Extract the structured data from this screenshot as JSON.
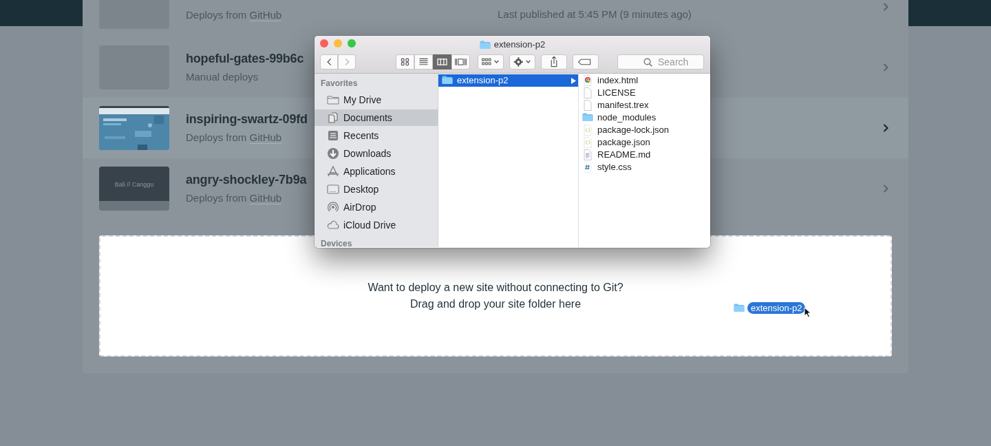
{
  "sites": [
    {
      "source": "Deploys from ",
      "source_link": "GitHub",
      "published": "Last published at 5:45 PM (9 minutes ago)",
      "thumbnail": {
        "kind": "blank"
      },
      "highlighted": false
    },
    {
      "name": "hopeful-gates-99b6c",
      "source": "Manual deploys",
      "thumbnail": {
        "kind": "blank"
      },
      "highlighted": false
    },
    {
      "name": "inspiring-swartz-09fd",
      "source": "Deploys from ",
      "source_link": "GitHub",
      "highlighted": true
    },
    {
      "name": "angry-shockley-7b9a",
      "source": "Deploys from ",
      "source_link": "GitHub",
      "thumbnail": {
        "kind": "caption",
        "caption": "Bali // Canggu"
      },
      "highlighted": false
    }
  ],
  "dropzone": {
    "lines": [
      "Want to deploy a new site without connecting to Git?",
      "Drag and drop your site folder here"
    ],
    "drag_item": {
      "label": "extension-p2"
    }
  },
  "finder": {
    "title": "extension-p2",
    "back": {
      "disabled": false
    },
    "forward": {
      "disabled": true
    },
    "view_modes": [
      {
        "kind": "icons",
        "selected": false
      },
      {
        "kind": "list",
        "selected": false
      },
      {
        "kind": "columns",
        "selected": true
      },
      {
        "kind": "gallery",
        "selected": false
      }
    ],
    "search": {
      "placeholder": "Search"
    },
    "sidebar": [
      {
        "heading": "Favorites",
        "items": [
          {
            "label": "My Drive",
            "kind": "drive",
            "selected": false
          },
          {
            "label": "Documents",
            "kind": "documents",
            "selected": true
          },
          {
            "label": "Recents",
            "kind": "recents",
            "selected": false
          },
          {
            "label": "Downloads",
            "kind": "downloads",
            "selected": false
          },
          {
            "label": "Applications",
            "kind": "applications",
            "selected": false
          },
          {
            "label": "Desktop",
            "kind": "desktop",
            "selected": false
          },
          {
            "label": "AirDrop",
            "kind": "airdrop",
            "selected": false
          },
          {
            "label": "iCloud Drive",
            "kind": "icloud",
            "selected": false
          }
        ]
      },
      {
        "heading": "Devices"
      }
    ],
    "columns": [
      [
        {
          "name": "extension-p2",
          "kind": "folder",
          "selected": true
        }
      ],
      [
        {
          "name": "index.html",
          "kind": "html",
          "selected": false
        },
        {
          "name": "LICENSE",
          "kind": "file",
          "selected": false
        },
        {
          "name": "manifest.trex",
          "kind": "file",
          "selected": false
        },
        {
          "name": "node_modules",
          "kind": "folder",
          "selected": false
        },
        {
          "name": "package-lock.json",
          "kind": "json",
          "selected": false
        },
        {
          "name": "package.json",
          "kind": "json",
          "selected": false
        },
        {
          "name": "README.md",
          "kind": "text",
          "selected": false
        },
        {
          "name": "style.css",
          "kind": "css",
          "selected": false
        }
      ]
    ]
  }
}
